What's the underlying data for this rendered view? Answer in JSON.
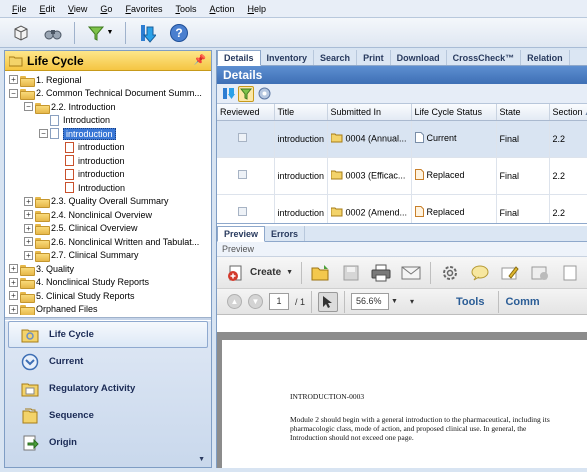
{
  "menu": [
    "File",
    "Edit",
    "View",
    "Go",
    "Favorites",
    "Tools",
    "Action",
    "Help"
  ],
  "left_panel": {
    "title": "Life Cycle",
    "tree": [
      {
        "label": "1. Regional",
        "level": 0,
        "expander": "+",
        "icon": "folder"
      },
      {
        "label": "2. Common Technical Document Summ...",
        "level": 0,
        "expander": "-",
        "icon": "folder"
      },
      {
        "label": "2.2. Introduction",
        "level": 1,
        "expander": "-",
        "icon": "folder"
      },
      {
        "label": "Introduction",
        "level": 2,
        "expander": "",
        "icon": "doc"
      },
      {
        "label": "introduction",
        "level": 2,
        "expander": "-",
        "icon": "doc",
        "selected": true
      },
      {
        "label": "introduction",
        "level": 3,
        "expander": "",
        "icon": "doc-red"
      },
      {
        "label": "introduction",
        "level": 3,
        "expander": "",
        "icon": "doc-red"
      },
      {
        "label": "introduction",
        "level": 3,
        "expander": "",
        "icon": "doc-red"
      },
      {
        "label": "Introduction",
        "level": 3,
        "expander": "",
        "icon": "doc-red"
      },
      {
        "label": "2.3. Quality Overall Summary",
        "level": 1,
        "expander": "+",
        "icon": "folder"
      },
      {
        "label": "2.4. Nonclinical Overview",
        "level": 1,
        "expander": "+",
        "icon": "folder"
      },
      {
        "label": "2.5. Clinical Overview",
        "level": 1,
        "expander": "+",
        "icon": "folder"
      },
      {
        "label": "2.6. Nonclinical Written and Tabulat...",
        "level": 1,
        "expander": "+",
        "icon": "folder"
      },
      {
        "label": "2.7. Clinical Summary",
        "level": 1,
        "expander": "+",
        "icon": "folder"
      },
      {
        "label": "3. Quality",
        "level": 0,
        "expander": "+",
        "icon": "folder"
      },
      {
        "label": "4. Nonclinical Study Reports",
        "level": 0,
        "expander": "+",
        "icon": "folder"
      },
      {
        "label": "5. Clinical Study Reports",
        "level": 0,
        "expander": "+",
        "icon": "folder"
      },
      {
        "label": "Orphaned Files",
        "level": 0,
        "expander": "+",
        "icon": "folder"
      }
    ],
    "nav": [
      {
        "label": "Life Cycle",
        "icon": "life-cycle-icon",
        "active": true
      },
      {
        "label": "Current",
        "icon": "current-icon",
        "active": false
      },
      {
        "label": "Regulatory Activity",
        "icon": "regulatory-activity-icon",
        "active": false
      },
      {
        "label": "Sequence",
        "icon": "sequence-icon",
        "active": false
      },
      {
        "label": "Origin",
        "icon": "origin-icon",
        "active": false
      }
    ]
  },
  "right_panel": {
    "tabs": [
      "Details",
      "Inventory",
      "Search",
      "Print",
      "Download",
      "CrossCheck™",
      "Relation"
    ],
    "details_title": "Details",
    "columns": [
      "Reviewed",
      "Title",
      "Submitted In",
      "Life Cycle Status",
      "State",
      "Section"
    ],
    "rows": [
      {
        "title": "introduction",
        "submitted": "0004 (Annual...",
        "status": "Current",
        "state": "Final",
        "section": "2.2",
        "selected": true
      },
      {
        "title": "introduction",
        "submitted": "0003 (Efficac...",
        "status": "Replaced",
        "state": "Final",
        "section": "2.2",
        "selected": false
      },
      {
        "title": "introduction",
        "submitted": "0002 (Amend...",
        "status": "Replaced",
        "state": "Final",
        "section": "2.2",
        "selected": false
      }
    ],
    "lower_tabs": [
      "Preview",
      "Errors"
    ],
    "preview_label": "Preview",
    "pdf": {
      "create_label": "Create",
      "page_current": "1",
      "page_total": "/ 1",
      "zoom": "56.6%",
      "tools_label": "Tools",
      "comment_label": "Comm",
      "doc_heading": "INTRODUCTION-0003",
      "doc_line1": "Module 2 should begin with a general introduction to the pharmaceutical, including its",
      "doc_line2": "pharmacologic class, mode of action, and proposed clinical use.  In general, the",
      "doc_line3": "Introduction should not exceed one page."
    }
  }
}
